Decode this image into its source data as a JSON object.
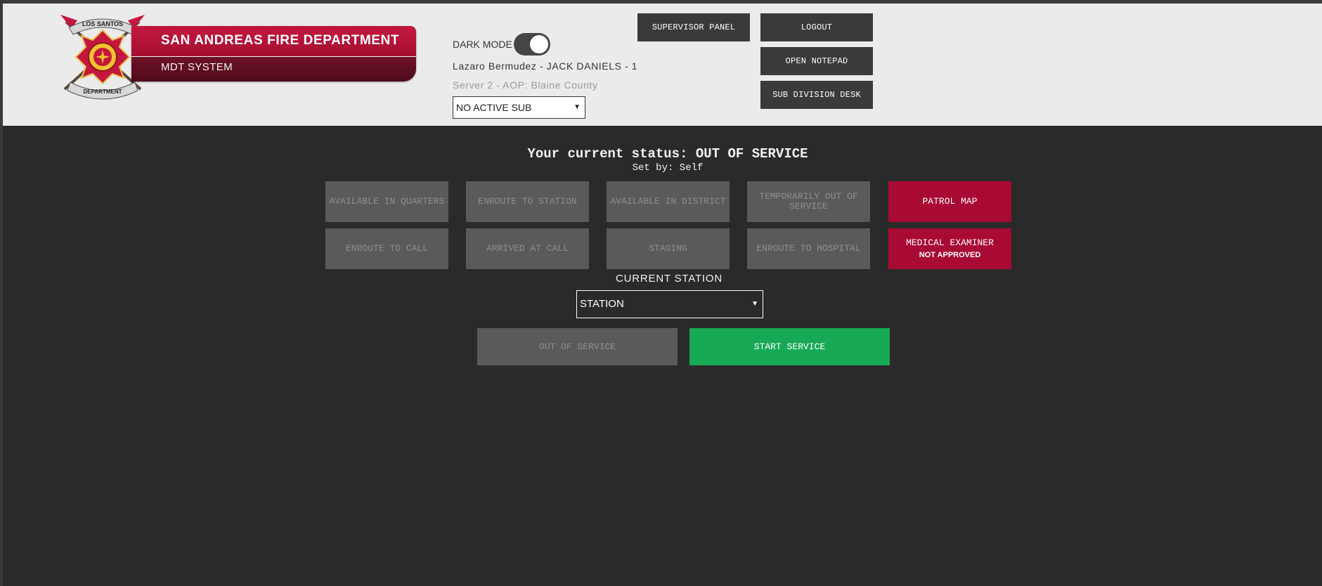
{
  "header": {
    "badge": {
      "top_text": "LOS SANTOS",
      "bottom_text": "DEPARTMENT"
    },
    "title": "SAN ANDREAS FIRE DEPARTMENT",
    "subtitle": "MDT SYSTEM",
    "dark_mode_label": "DARK MODE",
    "dark_mode_on": true,
    "user_line": "Lazaro Bermudez  - JACK DANIELS  - 1",
    "server_line": "Server 2 - AOP: Blaine County",
    "sub_select_value": "NO ACTIVE SUB",
    "buttons": {
      "supervisor": "SUPERVISOR PANEL",
      "logout": "LOGOUT",
      "notepad": "OPEN NOTEPAD",
      "subdivision": "SUB DIVISION DESK"
    }
  },
  "status": {
    "title": "Your current status: OUT OF SERVICE",
    "set_by": "Set by: Self"
  },
  "status_buttons": [
    "AVAILABLE IN QUARTERS",
    "ENROUTE TO STATION",
    "AVAILABLE IN DISTRICT",
    "TEMPORARILY OUT OF SERVICE",
    "ENROUTE TO CALL",
    "ARRIVED AT CALL",
    "STAGING",
    "ENROUTE TO HOSPITAL"
  ],
  "side_buttons": {
    "patrol_map": "PATROL MAP",
    "medical_examiner": "MEDICAL EXAMINER",
    "medical_examiner_note": "NOT APPROVED"
  },
  "station": {
    "label": "CURRENT STATION",
    "value": "STATION"
  },
  "service_buttons": {
    "out_of_service": "OUT OF SERVICE",
    "start_service": "START SERVICE"
  },
  "colors": {
    "accent_red": "#a80a33",
    "start_green": "#18a956",
    "disabled_gray": "#5a5a5a",
    "header_bg": "#ebebeb",
    "body_bg": "#2a2a2a"
  },
  "icons": {
    "badge": "fire-department-badge-icon",
    "select_arrow": "dropdown-arrow-icon"
  }
}
